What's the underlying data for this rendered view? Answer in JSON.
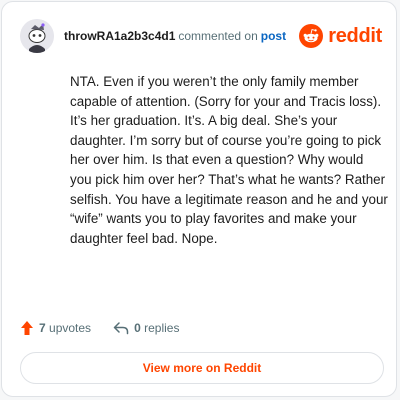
{
  "comment": {
    "author": "throwRA1a2b3c4d1",
    "action": "commented on",
    "post_link": "post",
    "brand": "reddit",
    "text": "NTA. Even if you weren’t the only family member capable of attention. (Sorry for your and Tracis loss). It’s her graduation. It’s. A big deal. She’s your daughter. I’m sorry but of course you’re going to pick her over him. Is that even a question? Why would you pick him over her? That’s what he wants? Rather selfish. You have a legitimate reason and he and your “wife” wants you to play favorites and make your daughter feel bad. Nope.",
    "upvotes_count": "7",
    "upvotes_label": "upvotes",
    "replies_count": "0",
    "replies_label": "replies",
    "view_button": "View more on Reddit"
  },
  "colors": {
    "accent": "#ff4500",
    "link": "#0a66c2",
    "muted": "#576f76",
    "text": "#1c1c1c"
  },
  "icons": {
    "avatar": "snoo-avatar",
    "logo": "reddit-logo-icon",
    "upvote": "upvote-arrow-icon",
    "reply": "reply-arrow-icon"
  }
}
